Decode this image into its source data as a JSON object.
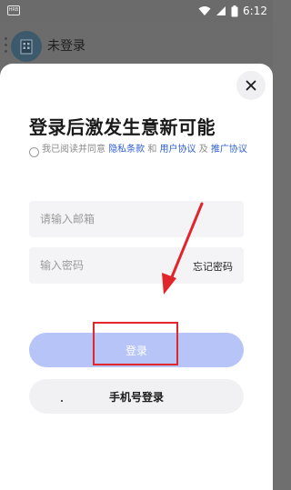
{
  "statusbar": {
    "left_icon_label": "HRB",
    "time": "6:12",
    "icons": [
      "wifi-icon",
      "signal-icon",
      "battery-icon"
    ]
  },
  "background": {
    "user_name": "未登录",
    "avatar_icon": "building-icon"
  },
  "dialog": {
    "close_icon": "close-icon",
    "title": "登录后激发生意新可能",
    "agreement": {
      "prefix": "我已阅读并同意 ",
      "privacy_link": "隐私条款",
      "and": " 和 ",
      "user_link": "用户协议",
      "and2": " 及 ",
      "promo_link": "推广协议"
    },
    "email_placeholder": "请输入邮箱",
    "password_placeholder": "输入密码",
    "forgot_label": "忘记密码",
    "login_label": "登录",
    "phone_login_label": "手机号登录"
  },
  "colors": {
    "link": "#2f5fd6",
    "login_button": "#b6c4f7",
    "annotation": "#e0262b",
    "field_bg": "#f4f4f6"
  }
}
